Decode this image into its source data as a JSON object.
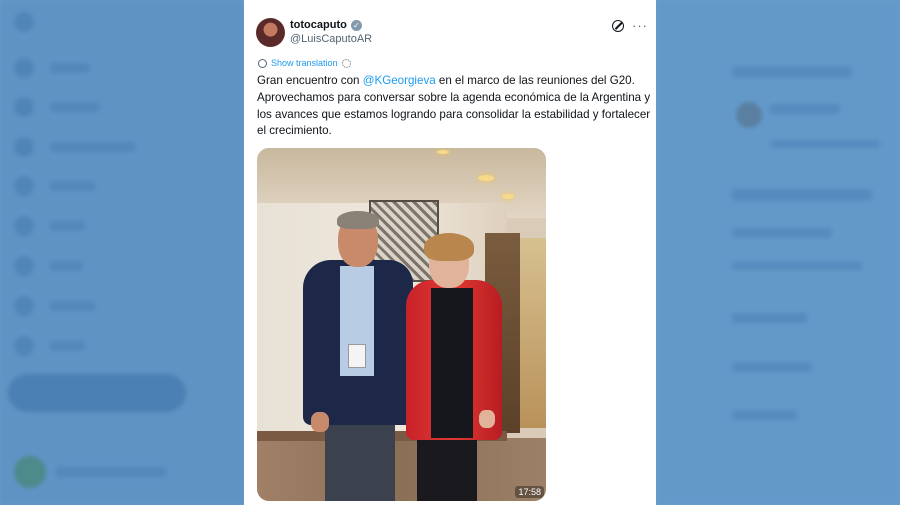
{
  "tweet": {
    "display_name": "totocaputo",
    "handle": "@LuisCaputoAR",
    "show_translation": "Show translation",
    "text_before_mention": "Gran encuentro con ",
    "mention": "@KGeorgieva",
    "text_after_mention": " en el marco de las reuniones del G20. Aprovechamos para conversar sobre la agenda económica de la Argentina y los avances que estamos logrando para consolidar la estabilidad y fortalecer el crecimiento.",
    "more_label": "···",
    "media_timestamp": "17:58"
  },
  "icons": {
    "avatar": "avatar-photo",
    "verified": "verified-badge-icon",
    "grok": "grok-icon",
    "more": "more-options-icon",
    "translate": "globe-icon",
    "settings": "gear-icon"
  },
  "colors": {
    "link": "#1d9bf0",
    "text": "#0f1419",
    "secondary_text": "#536471",
    "background_overlay": "#6a9cc9"
  }
}
